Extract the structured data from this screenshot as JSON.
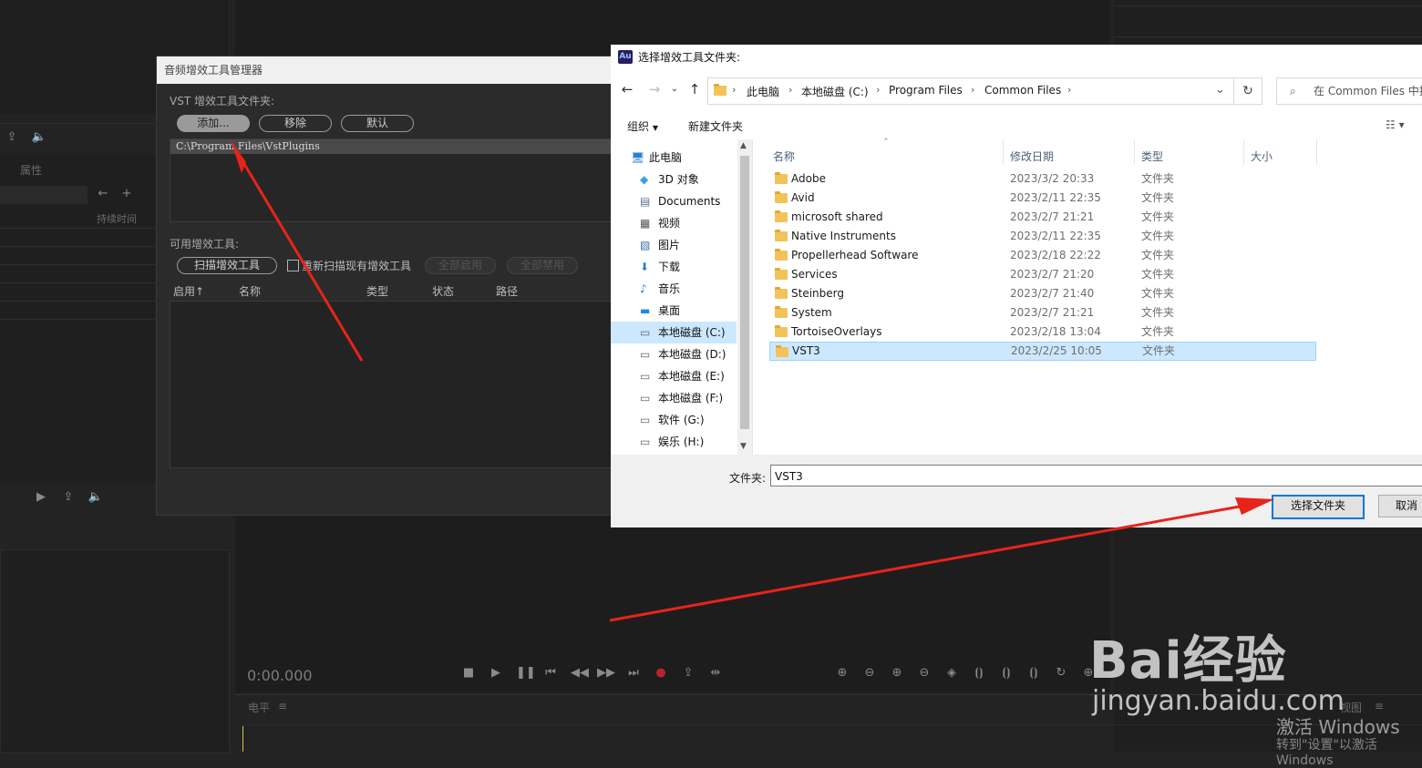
{
  "background": {
    "left_panel_label": "属性",
    "duration_label": "持续时间",
    "time_display": "0:00.000",
    "level_label": "电平",
    "right_label": "视图"
  },
  "plugin_manager": {
    "title": "音频增效工具管理器",
    "vst_folder_label": "VST 增效工具文件夹:",
    "buttons": {
      "add": "添加...",
      "remove": "移除",
      "default": "默认"
    },
    "folders": [
      "C:\\Program Files\\VstPlugins"
    ],
    "available_label": "可用增效工具:",
    "scan_button": "扫描增效工具",
    "rescan_checkbox": "重新扫描现有增效工具",
    "enable_all": "全部启用",
    "disable_all": "全部禁用",
    "columns": [
      "启用",
      "名称",
      "类型",
      "状态",
      "路径"
    ]
  },
  "folder_dialog": {
    "title": "选择增效工具文件夹:",
    "app_badge": "Au",
    "breadcrumb": [
      "此电脑",
      "本地磁盘 (C:)",
      "Program Files",
      "Common Files"
    ],
    "search_placeholder": "在 Common Files 中搜",
    "toolbar": {
      "organize": "组织",
      "new_folder": "新建文件夹"
    },
    "nav_items": [
      {
        "label": "此电脑",
        "icon": "computer-icon"
      },
      {
        "label": "3D 对象",
        "icon": "3d-objects-icon"
      },
      {
        "label": "Documents",
        "icon": "documents-icon"
      },
      {
        "label": "视频",
        "icon": "video-icon"
      },
      {
        "label": "图片",
        "icon": "pictures-icon"
      },
      {
        "label": "下载",
        "icon": "download-icon"
      },
      {
        "label": "音乐",
        "icon": "music-icon"
      },
      {
        "label": "桌面",
        "icon": "desktop-icon"
      },
      {
        "label": "本地磁盘 (C:)",
        "icon": "drive-icon"
      },
      {
        "label": "本地磁盘 (D:)",
        "icon": "drive-icon"
      },
      {
        "label": "本地磁盘 (E:)",
        "icon": "drive-icon"
      },
      {
        "label": "本地磁盘 (F:)",
        "icon": "drive-icon"
      },
      {
        "label": "软件 (G:)",
        "icon": "drive-icon"
      },
      {
        "label": "娱乐 (H:)",
        "icon": "drive-icon"
      }
    ],
    "columns": {
      "name": "名称",
      "modified": "修改日期",
      "type": "类型",
      "size": "大小"
    },
    "files": [
      {
        "name": "Adobe",
        "date": "2023/3/2 20:33",
        "type": "文件夹"
      },
      {
        "name": "Avid",
        "date": "2023/2/11 22:35",
        "type": "文件夹"
      },
      {
        "name": "microsoft shared",
        "date": "2023/2/7 21:21",
        "type": "文件夹"
      },
      {
        "name": "Native Instruments",
        "date": "2023/2/11 22:35",
        "type": "文件夹"
      },
      {
        "name": "Propellerhead Software",
        "date": "2023/2/18 22:22",
        "type": "文件夹"
      },
      {
        "name": "Services",
        "date": "2023/2/7 21:20",
        "type": "文件夹"
      },
      {
        "name": "Steinberg",
        "date": "2023/2/7 21:40",
        "type": "文件夹"
      },
      {
        "name": "System",
        "date": "2023/2/7 21:21",
        "type": "文件夹"
      },
      {
        "name": "TortoiseOverlays",
        "date": "2023/2/18 13:04",
        "type": "文件夹"
      },
      {
        "name": "VST3",
        "date": "2023/2/25 10:05",
        "type": "文件夹"
      }
    ],
    "folder_label": "文件夹:",
    "folder_value": "VST3",
    "select_button": "选择文件夹",
    "cancel_button": "取消"
  },
  "watermark": {
    "line1": "激活 Windows",
    "line2": "转到\"设置\"以激活 Windows",
    "baidu": "Bai经验",
    "baidu_url": "jingyan.baidu.com"
  },
  "colors": {
    "arrow": "#e8231b",
    "selection": "#cce8ff",
    "accent": "#0078d7"
  }
}
